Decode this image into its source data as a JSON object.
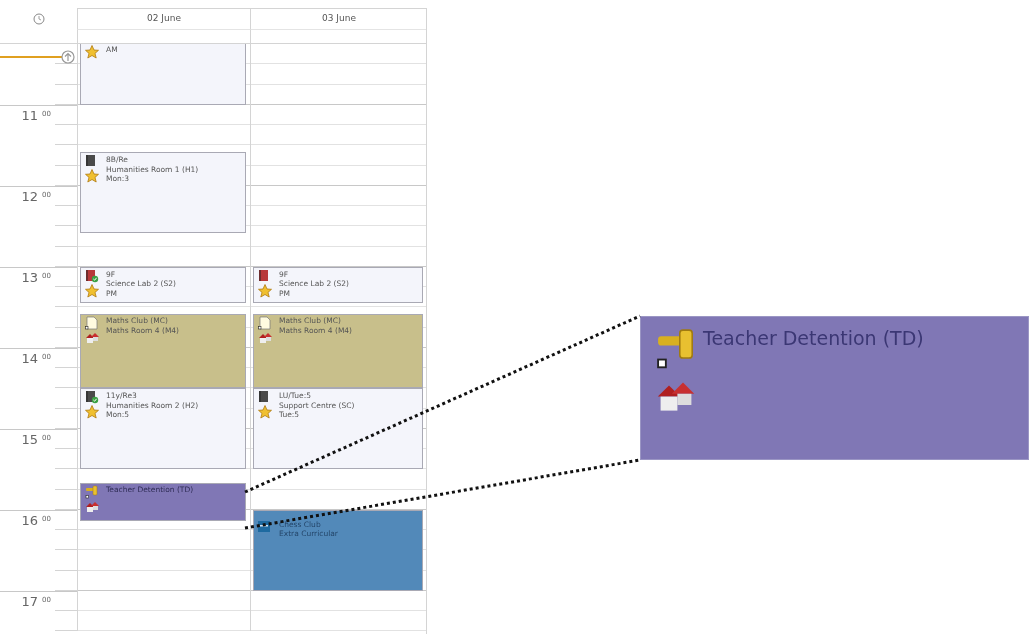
{
  "days": [
    {
      "label": "02 June",
      "events": [
        {
          "kind": "lesson_partial",
          "color": "#f4f5fb",
          "lines": [
            "AM"
          ]
        },
        {
          "kind": "lesson",
          "checked": false,
          "color": "#f4f5fb",
          "lines": [
            "8B/Re",
            "Humanities Room 1 (H1)",
            "Mon:3"
          ]
        },
        {
          "kind": "lesson",
          "checked": true,
          "color": "#f4f5fb",
          "lines": [
            "9F",
            "Science Lab 2 (S2)",
            "PM"
          ]
        },
        {
          "kind": "activity",
          "color": "#c8bf8b",
          "lines": [
            "Maths Club (MC)",
            "Maths Room 4 (M4)"
          ]
        },
        {
          "kind": "lesson",
          "checked": true,
          "color": "#f4f5fb",
          "lines": [
            "11y/Re3",
            "Humanities Room 2 (H2)",
            "Mon:5"
          ]
        },
        {
          "kind": "detention",
          "color": "#8077b5",
          "lines": [
            "Teacher Detention (TD)"
          ]
        }
      ]
    },
    {
      "label": "03 June",
      "events": [
        {
          "kind": "lesson",
          "checked": false,
          "color": "#f4f5fb",
          "lines": [
            "9F",
            "Science Lab 2 (S2)",
            "PM"
          ]
        },
        {
          "kind": "activity",
          "color": "#c8bf8b",
          "lines": [
            "Maths Club (MC)",
            "Maths Room 4 (M4)"
          ]
        },
        {
          "kind": "lesson",
          "checked": false,
          "color": "#f4f5fb",
          "lines": [
            "LU/Tue:5",
            "Support Centre (SC)",
            "Tue:5"
          ]
        },
        {
          "kind": "club",
          "color": "#5289b9",
          "lines": [
            "Chess Club",
            "Extra Curricular"
          ]
        }
      ]
    }
  ],
  "hours": [
    {
      "hour": "11",
      "minutes": "00"
    },
    {
      "hour": "12",
      "minutes": "00"
    },
    {
      "hour": "13",
      "minutes": "00"
    },
    {
      "hour": "14",
      "minutes": "00"
    },
    {
      "hour": "15",
      "minutes": "00"
    },
    {
      "hour": "16",
      "minutes": "00"
    },
    {
      "hour": "17",
      "minutes": "00"
    }
  ],
  "callout": {
    "title": "Teacher Detention (TD)"
  }
}
